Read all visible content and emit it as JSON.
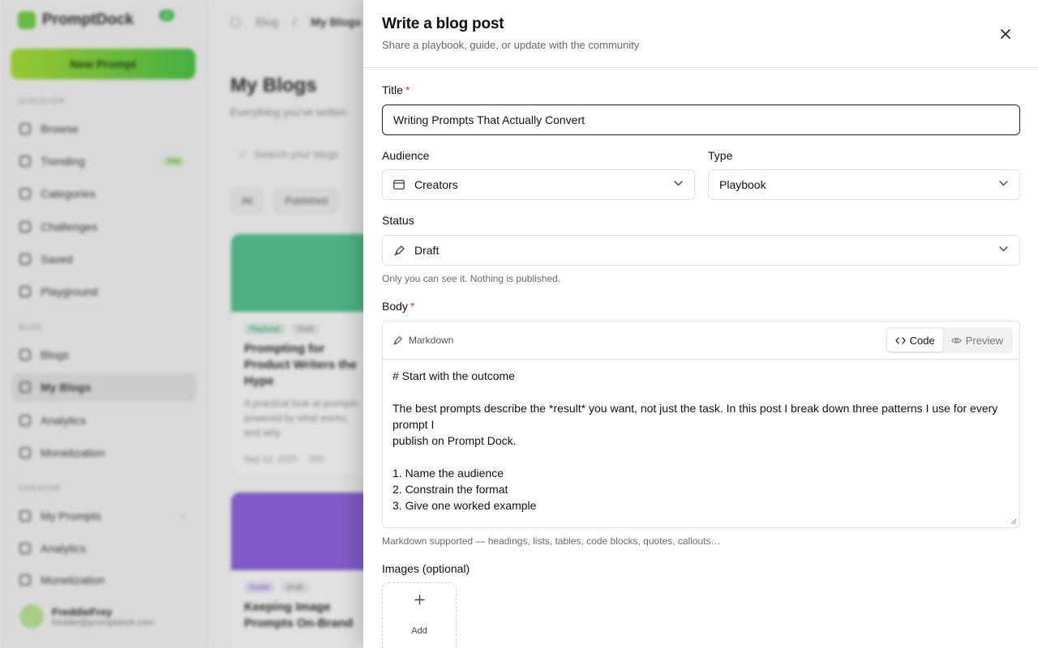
{
  "background": {
    "brand": "PromptDock",
    "brand_badge": "AI",
    "new_button": "New Prompt",
    "sections": [
      "Discover",
      "Blog",
      "Creator"
    ],
    "nav": [
      {
        "label": "Browse",
        "count": ""
      },
      {
        "label": "Trending",
        "count": "Hot"
      },
      {
        "label": "Categories",
        "count": ""
      },
      {
        "label": "Challenges",
        "count": ""
      },
      {
        "label": "Saved",
        "count": ""
      },
      {
        "label": "Playground",
        "count": ""
      },
      {
        "label": "Blogs",
        "count": ""
      },
      {
        "label": "My Blogs",
        "count": ""
      },
      {
        "label": "Analytics",
        "count": ""
      },
      {
        "label": "Monetization",
        "count": ""
      },
      {
        "label": "My Prompts",
        "count": ""
      },
      {
        "label": "Analytics",
        "count": ""
      },
      {
        "label": "Monetization",
        "count": ""
      }
    ],
    "user_name": "FreddieFrey",
    "user_email": "freddie@promptdock.com",
    "breadcrumb": [
      "Blog",
      "My Blogs"
    ],
    "page_title": "My Blogs",
    "page_subtitle": "Everything you've written",
    "search_placeholder": "Search your blogs",
    "filters": [
      "All",
      "Published"
    ],
    "cards": [
      {
        "tag1": "Playbook",
        "tag2": "Draft",
        "title": "Prompting for Product Writers the Hype",
        "desc": "A practical look at prompts powered by what works, and why",
        "date": "Sep 12, 2025",
        "stat": "320"
      },
      {
        "tag1": "Guide",
        "tag2": "Draft",
        "title": "Keeping Image Prompts On-Brand",
        "desc": "",
        "date": "",
        "stat": ""
      }
    ]
  },
  "drawer": {
    "title": "Write a blog post",
    "subtitle": "Share a playbook, guide, or update with the community",
    "close_icon": "close-icon",
    "title_label": "Title",
    "title_value": "Writing Prompts That Actually Convert",
    "required_mark": "*",
    "audience_label": "Audience",
    "audience_value": "Creators",
    "type_label": "Type",
    "type_value": "Playbook",
    "status_label": "Status",
    "status_value": "Draft",
    "status_helper": "Only you can see it. Nothing is published.",
    "body_label": "Body",
    "editor_mode": "Markdown",
    "tab_code": "Code",
    "tab_preview": "Preview",
    "body_lines": [
      "# Start with the outcome",
      "",
      "The best prompts describe the *result* you want, not just the task. In this post I break down three patterns I use for every prompt I",
      "publish on Prompt Dock.",
      "",
      "1. Name the audience",
      "2. Constrain the format",
      "3. Give one worked example"
    ],
    "body_helper": "Markdown supported — headings, lists, tables, code blocks, quotes, callouts…",
    "images_label": "Images (optional)",
    "add_label": "Add"
  },
  "colors": {
    "accent": "#41c33d",
    "required": "#e0403a",
    "border": "#e2e2e2"
  }
}
